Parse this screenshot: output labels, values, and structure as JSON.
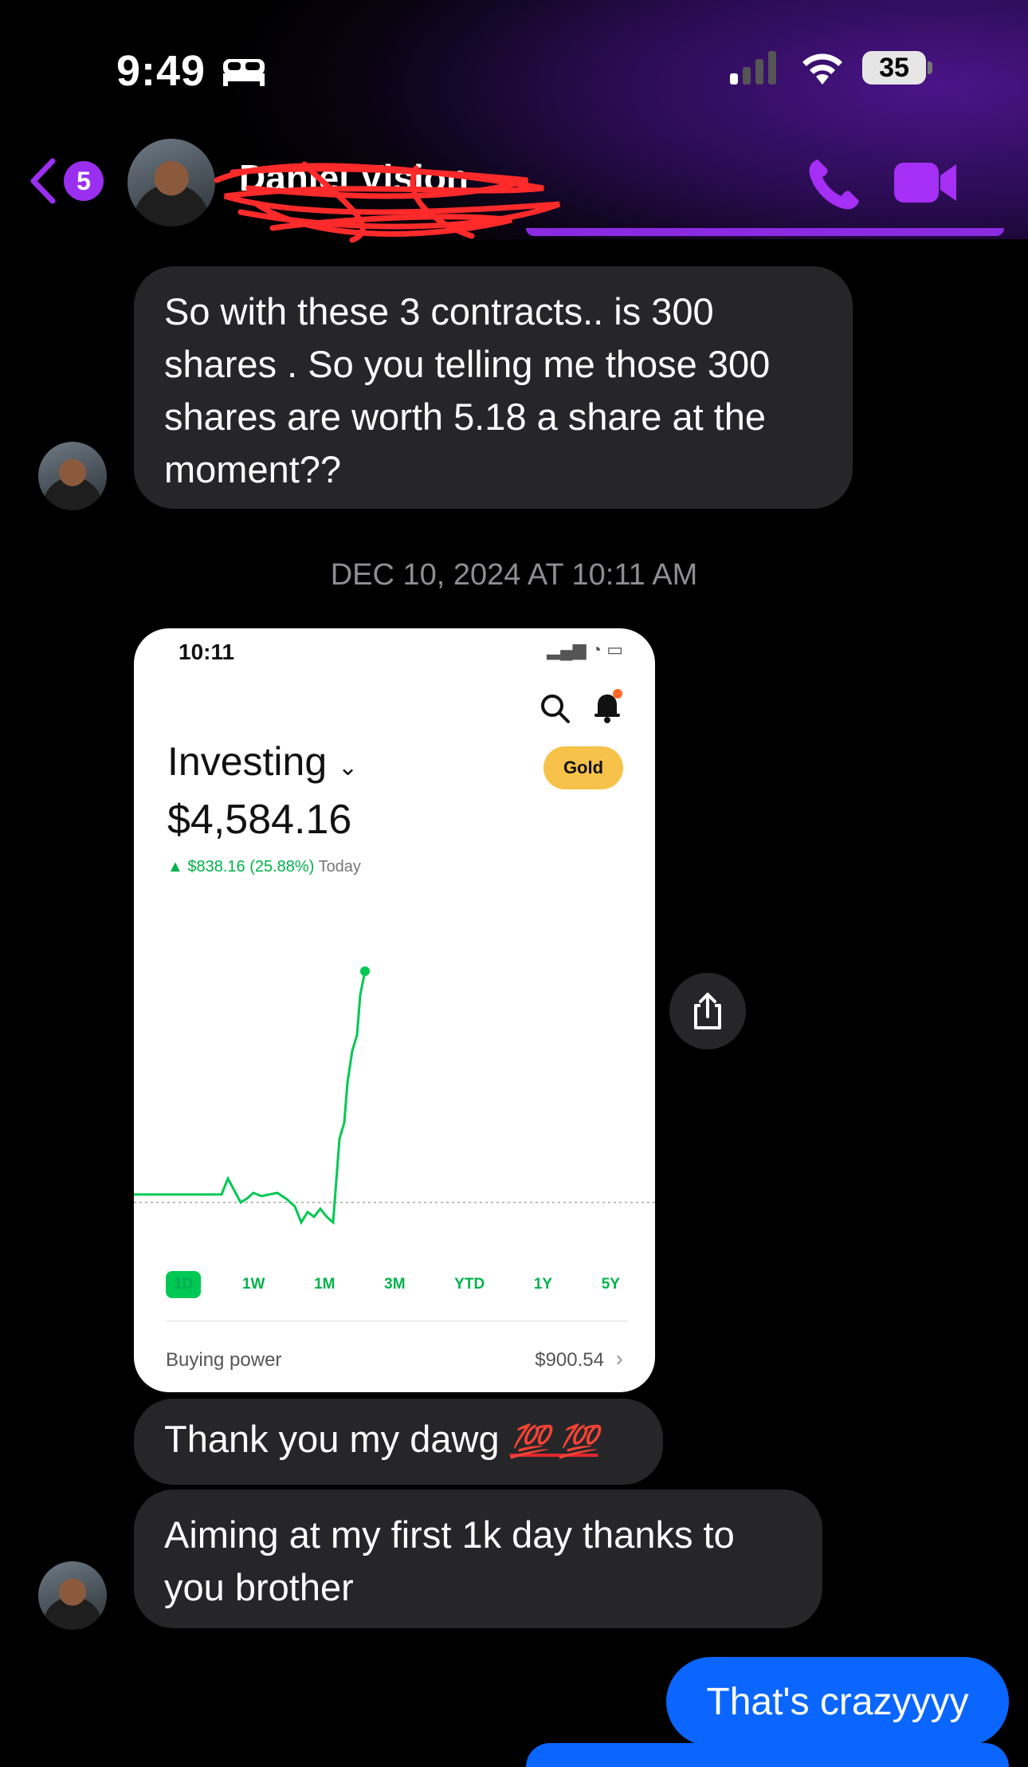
{
  "status_bar": {
    "time": "9:49",
    "focus_icon": "bed-icon",
    "battery": "35"
  },
  "header": {
    "back_count": "5",
    "contact_name": "Daniel Vision",
    "accent_color": "#9b2ff0"
  },
  "messages": {
    "m1": "So with these 3 contracts.. is 300 shares . So you telling me those 300 shares are worth 5.18 a share at the moment??",
    "timestamp": "DEC 10, 2024 AT 10:11 AM",
    "m2_text": "Thank you my dawg",
    "m2_emoji": "💯 💯",
    "m3": "Aiming at my first 1k day thanks to you brother",
    "out1": "That's crazyyyy"
  },
  "attachment": {
    "time": "10:11",
    "title": "Investing",
    "gold": "Gold",
    "value": "$4,584.16",
    "change": "▲ $838.16 (25.88%)",
    "change_suffix": "Today",
    "ranges": [
      "1D",
      "1W",
      "1M",
      "3M",
      "YTD",
      "1Y",
      "5Y"
    ],
    "active_range": "1D",
    "buying_power_label": "Buying power",
    "buying_power_value": "$900.54",
    "accent": "#00c853"
  }
}
